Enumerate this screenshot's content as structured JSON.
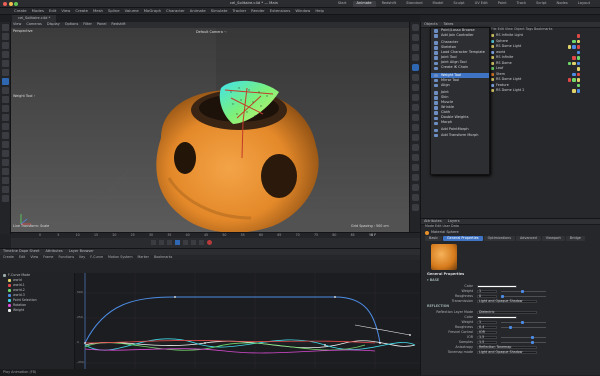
{
  "window": {
    "title": "cel_Solitaire.c4d * — Main",
    "tabs": [
      "Start",
      "Animate",
      "Redshift",
      "Standard",
      "Model",
      "Sculpt",
      "UV Edit",
      "Paint",
      "Track",
      "Script",
      "Nodes",
      "Layout"
    ],
    "active_tab": "Animate"
  },
  "menubar": [
    "Create",
    "Modes",
    "Edit",
    "View",
    "Create",
    "Mesh",
    "Spline",
    "Volume",
    "MoGraph",
    "Character",
    "Animate",
    "Simulate",
    "Tracker",
    "Render",
    "Extensions",
    "Window",
    "Help"
  ],
  "doc_tab": "cel_Solitaire.c4d *",
  "viewport": {
    "menu": [
      "View",
      "Cameras",
      "Display",
      "Options",
      "Filter",
      "Panel",
      "Redshift"
    ],
    "perspective_label": "Perspective",
    "camera_label": "Default Camera ·◦",
    "weight_label": "Weight Tool ◦",
    "transform_label": "Live Transform: Scale",
    "grid_label": "Grid Spacing : 500 cm"
  },
  "popup_menu": {
    "items": [
      {
        "label": "Point/Lasso Browse",
        "sel": false
      },
      {
        "label": "Add Join Controller",
        "sel": false
      },
      {
        "sep": true
      },
      {
        "label": "Character",
        "sel": false
      },
      {
        "label": "Skeleton",
        "sel": false
      },
      {
        "label": "Load Character Template",
        "sel": false
      },
      {
        "label": "Joint Tool",
        "sel": false
      },
      {
        "label": "Joint Align Tool",
        "sel": false
      },
      {
        "label": "Create IK Chain",
        "sel": false
      },
      {
        "sep": true
      },
      {
        "label": "Weight Tool",
        "sel": true
      },
      {
        "label": "Mirror Tool",
        "sel": false
      },
      {
        "label": "Align",
        "sel": false
      },
      {
        "sep": true
      },
      {
        "label": "Joint",
        "sel": false
      },
      {
        "label": "Skin",
        "sel": false
      },
      {
        "label": "Muscle",
        "sel": false
      },
      {
        "label": "Wrinkle",
        "sel": false
      },
      {
        "label": "Cloth",
        "sel": false
      },
      {
        "label": "Double Weights",
        "sel": false
      },
      {
        "label": "Morph",
        "sel": false
      },
      {
        "sep": true
      },
      {
        "label": "Add PointMorph",
        "sel": false
      },
      {
        "label": "Add Transform Morph",
        "sel": false
      }
    ]
  },
  "objects": {
    "tabs": [
      "Objects",
      "Takes"
    ],
    "menu": [
      "File",
      "Edit",
      "View",
      "Object",
      "Tags",
      "Bookmarks"
    ],
    "rows": [
      "RS Infinite Light",
      "Sphere",
      "RS Dome Light",
      "world",
      "RS Infinite",
      "RS Dome",
      "Leaf",
      "Stem",
      "RS Dome Light",
      "Feature",
      "RS Dome Light 2"
    ]
  },
  "attributes": {
    "tabs": [
      "Attributes",
      "Layers"
    ],
    "menu": [
      "Mode",
      "Edit",
      "User Data"
    ],
    "material_name": "Material Sphere",
    "subtabs": [
      "Basic",
      "General Properties",
      "Optimizations",
      "Advanced",
      "Viewport",
      "Bridge"
    ],
    "active_subtab": "General Properties",
    "section": "General Properties",
    "base_rows": [
      {
        "label": "Color",
        "value": ""
      },
      {
        "label": "Weight",
        "value": "1"
      },
      {
        "label": "Roughness",
        "value": "0"
      },
      {
        "label": "Transmission",
        "value": "Light and Opaque Shadow"
      }
    ],
    "reflection_header": "REFLECTION",
    "reflection_rows": [
      {
        "label": "Reflection Layer Mode",
        "value": "Dielectric"
      },
      {
        "label": "Color",
        "value": ""
      },
      {
        "label": "Weight",
        "value": "1"
      },
      {
        "label": "Roughness",
        "value": "0.4"
      },
      {
        "label": "Fresnel Control",
        "value": "IOR"
      },
      {
        "label": "IOR",
        "value": "1.5"
      },
      {
        "label": "Samples",
        "value": "1.5"
      },
      {
        "label": "Anisotropy",
        "value": "Reflection Tonemap"
      },
      {
        "label": "Tonemap mode",
        "value": "Light and Opaque Shadow"
      }
    ]
  },
  "timeline": {
    "ticks": [
      "0",
      "5",
      "10",
      "15",
      "20",
      "25",
      "30",
      "35",
      "40",
      "45",
      "50",
      "55",
      "60",
      "65",
      "70",
      "75",
      "80",
      "85",
      "90"
    ],
    "current": "0 F"
  },
  "fcurve": {
    "tabs": [
      "Timeline Dope Sheet",
      "Attributes",
      "Layer Browser"
    ],
    "menu": [
      "Create",
      "Edit",
      "View",
      "Frame",
      "Functions",
      "Key",
      "F-Curve",
      "Motion System",
      "Marker",
      "Bookmarks"
    ],
    "tree": [
      "F-Curve Mode",
      "world",
      "world.1",
      "world.2",
      "world.3",
      "Point Selection",
      "Rotation",
      "Weight"
    ],
    "ylabels": [
      "500",
      "250",
      "0",
      "-250"
    ]
  },
  "status": "Play Animation (F8)",
  "colors": {
    "accent": "#3f74c4",
    "orange": "#e8912a",
    "green": "#6fd86a",
    "cyan": "#3fd7e6"
  }
}
